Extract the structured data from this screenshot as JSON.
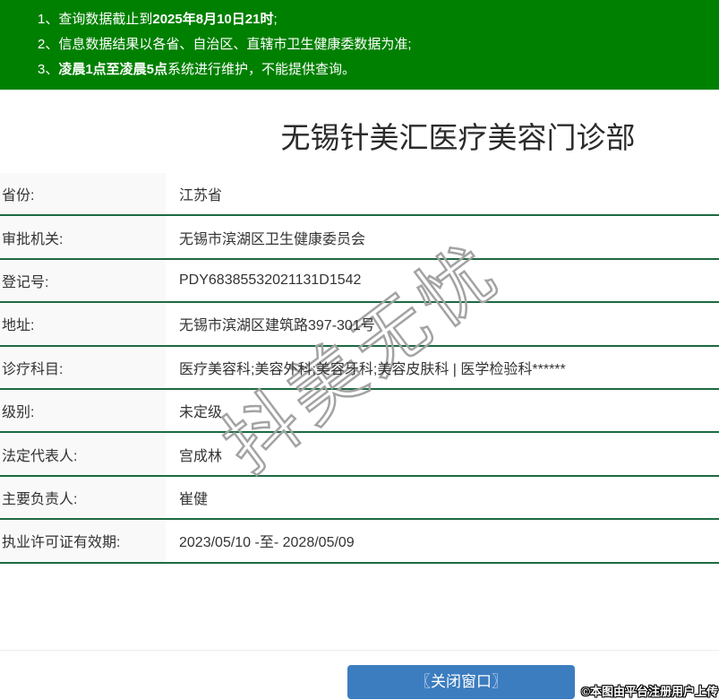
{
  "banner": {
    "bg_color": "#008000",
    "text_color": "#ffffff",
    "lines": [
      {
        "num": "1、",
        "pre": "查询数据截止到",
        "bold": "2025年8月10日21时",
        "post": ";"
      },
      {
        "num": "2、",
        "pre": "信息数据结果以各省、自治区、直辖市卫生健康委数据为准;",
        "bold": "",
        "post": ""
      },
      {
        "num": "3、",
        "pre": "",
        "bold": "凌晨1点至凌晨5点",
        "post": "系统进行维护，不能提供查询。"
      }
    ]
  },
  "page": {
    "title": "无锡针美汇医疗美容门诊部"
  },
  "info_table": {
    "divider_color": "#1d6a42",
    "label_bg": "#f9f9f9",
    "rows": [
      {
        "label": "省份:",
        "value": "江苏省"
      },
      {
        "label": "审批机关:",
        "value": "无锡市滨湖区卫生健康委员会"
      },
      {
        "label": "登记号:",
        "value": "PDY68385532021131D1542"
      },
      {
        "label": "地址:",
        "value": "无锡市滨湖区建筑路397-301号"
      },
      {
        "label": "诊疗科目:",
        "value": "医疗美容科;美容外科;美容牙科;美容皮肤科 | 医学检验科******"
      },
      {
        "label": "级别:",
        "value": "未定级"
      },
      {
        "label": "法定代表人:",
        "value": "宫成林"
      },
      {
        "label": "主要负责人:",
        "value": "崔健"
      },
      {
        "label": "执业许可证有效期:",
        "value": "2023/05/10 -至- 2028/05/09"
      }
    ]
  },
  "watermark": {
    "text": "抖美无忧"
  },
  "footer": {
    "close_button": "〖关闭窗口〗",
    "button_color": "#3c7dc0",
    "upload_note": "©本图由平台注册用户上传"
  }
}
